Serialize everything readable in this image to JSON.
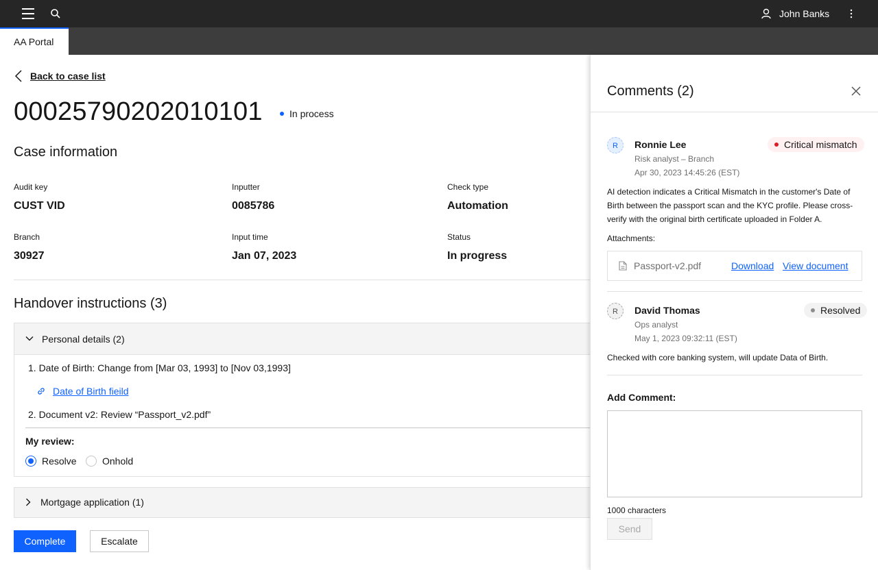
{
  "topbar": {
    "username": "John Banks"
  },
  "tabs": [
    {
      "label": "AA Portal"
    }
  ],
  "back_link": "Back to case list",
  "case": {
    "id": "000257902020101 01",
    "status": "In process"
  },
  "case_info": {
    "title": "Case information",
    "fields": [
      {
        "label": "Audit key",
        "value": "CUST VID"
      },
      {
        "label": "Inputter",
        "value": "0085786"
      },
      {
        "label": "Check type",
        "value": "Automation"
      },
      {
        "label": "Branch",
        "value": "30927"
      },
      {
        "label": "Input time",
        "value": "Jan 07, 2023"
      },
      {
        "label": "Status",
        "value": "In progress"
      }
    ]
  },
  "handover": {
    "title": "Handover instructions (3)",
    "sections": [
      {
        "title": "Personal details (2)",
        "items": [
          "1. Date of Birth: Change from [Mar 03, 1993] to [Nov 03,1993]",
          "2. Document v2: Review “Passport_v2.pdf”"
        ],
        "link": "Date of Birth fieild",
        "review_label": "My review:",
        "options": [
          "Resolve",
          "Onhold"
        ],
        "selected": "Resolve"
      },
      {
        "title": "Mortgage application (1)"
      }
    ]
  },
  "actions": {
    "complete": "Complete",
    "escalate": "Escalate"
  },
  "comments": {
    "title": "Comments (2)",
    "items": [
      {
        "initial": "R",
        "name": "Ronnie Lee",
        "role": "Risk analyst – Branch",
        "time": "Apr 30, 2023 14:45:26 (EST)",
        "badge": "Critical mismatch",
        "badge_color": "#da1e28",
        "body": "AI detection indicates a Critical Mismatch in the customer's Date of Birth between the passport scan and the KYC profile. Please cross-verify with the original birth certificate uploaded in Folder A.",
        "attachments_label": "Attachments:",
        "attachment": {
          "name": "Passport-v2.pdf",
          "download": "Download",
          "view": "View document"
        }
      },
      {
        "initial": "R",
        "name": "David Thomas",
        "role": "Ops analyst",
        "time": "May 1, 2023 09:32:11 (EST)",
        "badge": "Resolved",
        "badge_color": "#8d8d8d",
        "body": "Checked with core banking system, will update Data of Birth."
      }
    ],
    "add_label": "Add Comment:",
    "char_count": "1000 characters",
    "send": "Send"
  },
  "colors": {
    "primary": "#0f62fe",
    "topbar": "#262626",
    "tabbar": "#3d3d3d"
  }
}
